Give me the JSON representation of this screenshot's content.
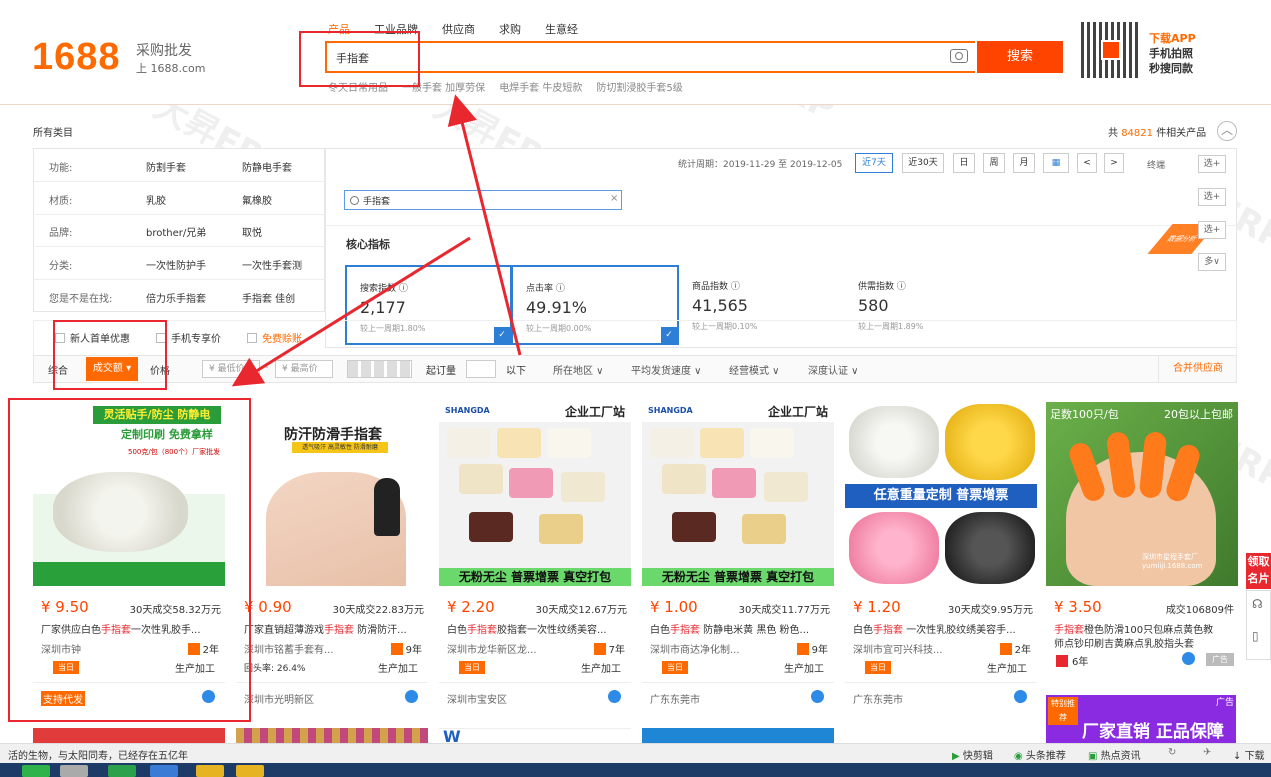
{
  "header": {
    "logo_number": "1688",
    "logo_slogan": "采购批发",
    "logo_url": "上 1688.com",
    "tabs": [
      {
        "label": "产品",
        "active": true
      },
      {
        "label": "工业品牌",
        "active": false
      },
      {
        "label": "供应商",
        "active": false
      },
      {
        "label": "求购",
        "active": false
      },
      {
        "label": "生意经",
        "active": false
      }
    ],
    "search_value": "手指套",
    "search_button": "搜索",
    "hot_searches": [
      "冬天日常用品",
      "一般手套 加厚劳保",
      "电焊手套 牛皮短款",
      "防切割浸胶手套5级"
    ],
    "app_line1": "下载APP",
    "app_line2": "手机拍照",
    "app_line3": "秒搜同款"
  },
  "category": {
    "all_label": "所有类目",
    "total_prefix": "共",
    "total_count": "84821",
    "total_suffix": "件相关产品",
    "rows": [
      {
        "key": "功能:",
        "v1": "防割手套",
        "v2": "防静电手套"
      },
      {
        "key": "材质:",
        "v1": "乳胶",
        "v2": "氟橡胶"
      },
      {
        "key": "品牌:",
        "v1": "brother/兄弟",
        "v2": "取悦"
      },
      {
        "key": "分类:",
        "v1": "一次性防护手",
        "v2": "一次性手套测"
      },
      {
        "key": "您是不是在找:",
        "v1": "倍力乐手指套",
        "v2": "手指套 佳创"
      }
    ]
  },
  "data_panel": {
    "period_label": "统计周期：2019-11-29 至 2019-12-05",
    "chips": [
      "近7天",
      "近30天",
      "日",
      "周",
      "月"
    ],
    "prev_label": "<",
    "next_label": ">",
    "final_label": "终端",
    "search_value": "手指套",
    "clear_label": "×",
    "core_title": "核心指标",
    "badge": "数据分析",
    "metrics": [
      {
        "title": "搜索指数 ⓘ",
        "value": "2,177",
        "sub": "较上一周期1.80%",
        "selected": true
      },
      {
        "title": "点击率 ⓘ",
        "value": "49.91%",
        "sub": "较上一周期0.00%",
        "selected": true
      },
      {
        "title": "商品指数 ⓘ",
        "value": "41,565",
        "sub": "较上一周期0.10%",
        "selected": false
      },
      {
        "title": "供需指数 ⓘ",
        "value": "580",
        "sub": "较上一周期1.89%",
        "selected": false
      }
    ],
    "side_buttons": [
      "选+",
      "选+",
      "选+",
      "多∨"
    ]
  },
  "checkboxes": [
    {
      "label": "新人首单优惠",
      "highlight": false
    },
    {
      "label": "手机专享价",
      "highlight": false
    },
    {
      "label": "免费赊账",
      "highlight": true
    }
  ],
  "sortbar": {
    "general": "综合",
    "sales": "成交额 ▾",
    "price": "价格",
    "price_min": "¥ 最低价",
    "price_dash": "-",
    "price_max": "¥ 最高价",
    "moq": "起订量",
    "below": "以下",
    "region": "所在地区 ∨",
    "delivery": "平均发货速度 ∨",
    "business": "经营模式 ∨",
    "cert": "深度认证 ∨",
    "merge": "合并供应商"
  },
  "products": [
    {
      "banner": "灵活贴手/防尘 防静电",
      "banner2": "定制印刷 免费拿样",
      "note": "500克/包（800个）厂家批发",
      "price": "¥ 9.50",
      "sold": "30天成交58.32万元",
      "title_pre": "厂家供应白色",
      "title_hl": "手指套",
      "title_post": "一次性乳胶手...",
      "loc": "深圳市钟",
      "years": "2年",
      "tag": "当日",
      "mode": "生产加工",
      "area": "支持代发"
    },
    {
      "banner": "防汗防滑手指套",
      "banner2": "透气吸汗 高灵敏性 防滑耐磨",
      "note": "",
      "price": "¥ 0.90",
      "sold": "30天成交22.83万元",
      "title_pre": "厂家直销超薄游戏",
      "title_hl": "手指套",
      "title_post": " 防滑防汗...",
      "loc": "深圳市铭蓄手套有...",
      "years": "9年",
      "tag": "回头率: 26.4%",
      "mode": "生产加工",
      "area": "深圳市光明新区"
    },
    {
      "banner": "企业工厂站",
      "banner2": "SHANGDA",
      "note": "无粉无尘  普票增票  真空打包",
      "price": "¥ 2.20",
      "sold": "30天成交12.67万元",
      "title_pre": "白色",
      "title_hl": "手指套",
      "title_post": "胶指套一次性纹绣美容...",
      "loc": "深圳市龙华新区龙...",
      "years": "7年",
      "tag": "当日",
      "mode": "生产加工",
      "area": "深圳市宝安区"
    },
    {
      "banner": "企业工厂站",
      "banner2": "SHANGDA",
      "note": "无粉无尘  普票增票  真空打包",
      "price": "¥ 1.00",
      "sold": "30天成交11.77万元",
      "title_pre": "白色",
      "title_hl": "手指套",
      "title_post": " 防静电米黄 黑色 粉色...",
      "loc": "深圳市商达净化制...",
      "years": "9年",
      "tag": "当日",
      "mode": "生产加工",
      "area": "广东东莞市"
    },
    {
      "banner": "任意重量定制 普票增票",
      "banner2": "",
      "note": "",
      "price": "¥ 1.20",
      "sold": "30天成交9.95万元",
      "title_pre": "白色",
      "title_hl": "手指套",
      "title_post": " 一次性乳胶纹绣美容手...",
      "loc": "深圳市宜可兴科技...",
      "years": "2年",
      "tag": "当日",
      "mode": "生产加工",
      "area": "广东东莞市"
    },
    {
      "banner": "足数100只/包",
      "banner2": "20包以上包邮",
      "note": "深圳市星程手套厂 yumiiji.1688.com",
      "price": "¥ 3.50",
      "sold": "成交106809件",
      "title_pre": "",
      "title_hl": "手指套",
      "title_post": "橙色防滑100只包麻点黄色教",
      "title2": "师点钞印刷吉黄麻点乳胶指头套",
      "loc": "",
      "years": "6年",
      "tag": "",
      "mode": "广告",
      "area": ""
    }
  ],
  "ad_banner": {
    "tag": "特别推荐",
    "text": "厂家直销 正品保障",
    "corner": "广告"
  },
  "side_float": "领取名片",
  "statusbar": {
    "left": "活的生物，与太阳同寿，已经存在五亿年",
    "items": [
      "快剪辑",
      "头条推荐",
      "热点资讯",
      "下载"
    ]
  },
  "watermark": "大昇ERP",
  "colors": {
    "brand": "#ff6a00",
    "search_btn": "#ff4400",
    "annotation": "#e8272e",
    "selected": "#2d7fd6"
  }
}
